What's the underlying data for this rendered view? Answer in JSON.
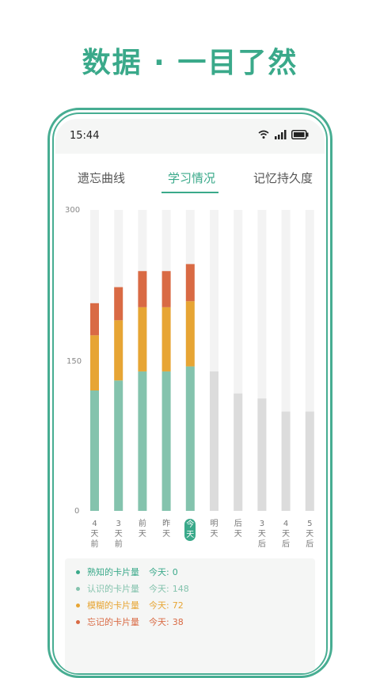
{
  "headline": "数据 · 一目了然",
  "status_bar": {
    "time": "15:44",
    "icons": [
      "wifi-icon",
      "signal-icon",
      "battery-icon"
    ]
  },
  "tabs": [
    {
      "label": "遗忘曲线",
      "active": false
    },
    {
      "label": "学习情况",
      "active": true
    },
    {
      "label": "记忆持久度",
      "active": false
    }
  ],
  "colors": {
    "accent": "#3aa98a",
    "familiar": "#84c3ad",
    "known": "#e7a534",
    "vague": "#d96a44",
    "future": "#dcdcdc",
    "track": "#f3f3f3"
  },
  "chart_data": {
    "type": "bar",
    "stacked": true,
    "ylim": [
      0,
      300
    ],
    "yticks": [
      "300",
      "150",
      "0"
    ],
    "categories": [
      "4天前",
      "3天前",
      "前天",
      "昨天",
      "今天",
      "明天",
      "后天",
      "3天后",
      "4天后",
      "5天后"
    ],
    "x_labels": [
      [
        "4",
        "天",
        "前"
      ],
      [
        "3",
        "天",
        "前"
      ],
      [
        "前",
        "天"
      ],
      [
        "昨",
        "天"
      ],
      [
        "今",
        "天"
      ],
      [
        "明",
        "天"
      ],
      [
        "后",
        "天"
      ],
      [
        "3",
        "天",
        "后"
      ],
      [
        "4",
        "天",
        "后"
      ],
      [
        "5",
        "天",
        "后"
      ]
    ],
    "today_index": 4,
    "series": [
      {
        "color": "#84c3ad",
        "values": [
          120,
          130,
          139,
          139,
          144,
          null,
          null,
          null,
          null,
          null
        ]
      },
      {
        "color": "#e7a534",
        "values": [
          55,
          60,
          64,
          64,
          65,
          null,
          null,
          null,
          null,
          null
        ]
      },
      {
        "color": "#d96a44",
        "values": [
          32,
          33,
          36,
          36,
          37,
          null,
          null,
          null,
          null,
          null
        ]
      },
      {
        "color": "#dcdcdc",
        "values": [
          null,
          null,
          null,
          null,
          null,
          139,
          117,
          112,
          99,
          99
        ]
      }
    ]
  },
  "legend": [
    {
      "label": "熟知的卡片量",
      "today_label": "今天:",
      "value": "0",
      "color": "#3aa98a"
    },
    {
      "label": "认识的卡片量",
      "today_label": "今天:",
      "value": "148",
      "color": "#84c3ad"
    },
    {
      "label": "模糊的卡片量",
      "today_label": "今天:",
      "value": "72",
      "color": "#e7a534"
    },
    {
      "label": "忘记的卡片量",
      "today_label": "今天:",
      "value": "38",
      "color": "#d96a44"
    }
  ]
}
